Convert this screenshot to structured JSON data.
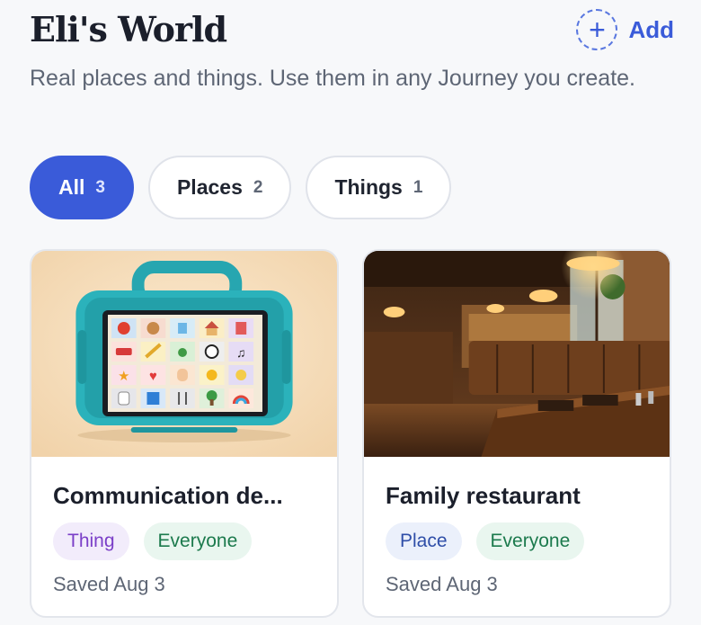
{
  "header": {
    "title": "Eli's World",
    "add_label": "Add",
    "add_icon": "plus-icon",
    "subtitle": "Real places and things. Use them in any Journey you create."
  },
  "filters": [
    {
      "label": "All",
      "count": "3",
      "active": true
    },
    {
      "label": "Places",
      "count": "2",
      "active": false
    },
    {
      "label": "Things",
      "count": "1",
      "active": false
    }
  ],
  "cards": [
    {
      "title": "Communication de...",
      "type_tag": "Thing",
      "audience_tag": "Everyone",
      "saved": "Saved Aug 3",
      "image": "communication-tablet-image"
    },
    {
      "title": "Family restaurant",
      "type_tag": "Place",
      "audience_tag": "Everyone",
      "saved": "Saved Aug 3",
      "image": "restaurant-image"
    }
  ],
  "colors": {
    "accent": "#3a5bd9",
    "background": "#f7f8fa",
    "thing_tag_text": "#7b3fc8",
    "place_tag_text": "#2f4ea8",
    "everyone_tag_text": "#1c7a4d"
  }
}
